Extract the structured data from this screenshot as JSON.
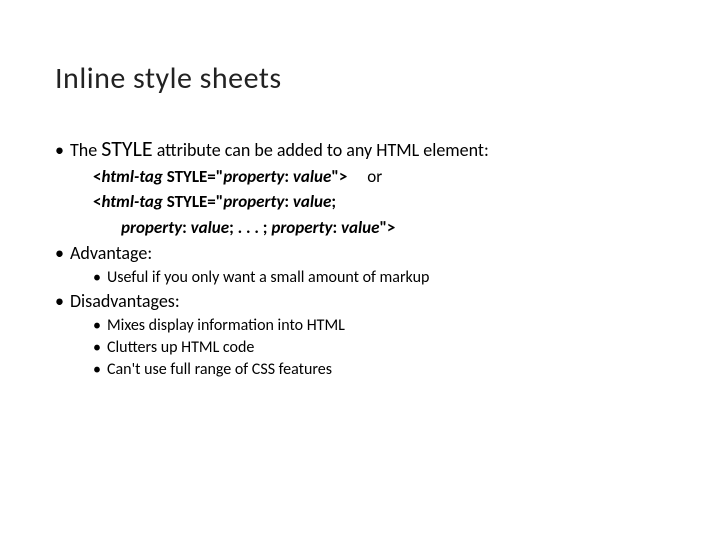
{
  "title": "Inline style sheets",
  "point1_pre": "The ",
  "point1_style": "STYLE",
  "point1_post": " attribute can be added to any HTML element:",
  "code_line1_a": "<",
  "code_line1_b": "html-tag",
  "code_line1_c": " STYLE=\"",
  "code_line1_d": "property",
  "code_line1_e": ": ",
  "code_line1_f": "value",
  "code_line1_g": "\">",
  "code_or": "or",
  "code_line2_a": "<",
  "code_line2_b": "html-tag",
  "code_line2_c": " STYLE=\"",
  "code_line2_d": "property",
  "code_line2_e": ": ",
  "code_line2_f": "value",
  "code_line2_g": ";",
  "code_line3_a": "property",
  "code_line3_b": ": ",
  "code_line3_c": "value",
  "code_line3_d": "; . . . ; ",
  "code_line3_e": "property",
  "code_line3_f": ": ",
  "code_line3_g": "value",
  "code_line3_h": "\">",
  "advantage_label": "Advantage:",
  "adv_item1": "Useful if you only want a small amount of markup",
  "disadvantage_label": "Disadvantages:",
  "dis_item1": "Mixes display information into HTML",
  "dis_item2": "Clutters up HTML code",
  "dis_item3": "Can't use full range of CSS features"
}
